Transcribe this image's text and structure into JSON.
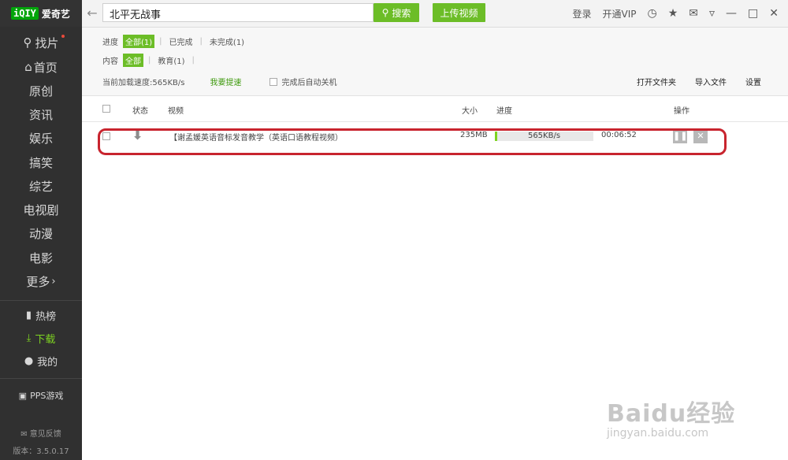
{
  "app": {
    "logo_mark": "iQIY",
    "logo_text": "爱奇艺"
  },
  "search": {
    "value": "北平无战事",
    "button": "搜索"
  },
  "upload_label": "上传视频",
  "top_right": {
    "login": "登录",
    "vip": "开通VIP"
  },
  "sidebar": {
    "find": "找片",
    "items": [
      "首页",
      "原创",
      "资讯",
      "娱乐",
      "搞笑",
      "综艺",
      "电视剧",
      "动漫",
      "电影",
      "更多"
    ],
    "more_arrow": "›",
    "hot": "热榜",
    "download": "下载",
    "mine": "我的",
    "games": "PPS游戏",
    "feedback": "意见反馈",
    "version": "版本：3.5.0.17"
  },
  "filters": {
    "progress_label": "进度",
    "progress_options": [
      "全部(1)",
      "已完成",
      "未完成(1)"
    ],
    "content_label": "内容",
    "content_options": [
      "全部",
      "教育(1)"
    ],
    "speed_text": "当前加载速度:565KB/s",
    "accelerate": "我要提速",
    "autoshutdown": "完成后自动关机",
    "actions": [
      "打开文件夹",
      "导入文件",
      "设置"
    ]
  },
  "table": {
    "headers": {
      "status": "状态",
      "video": "视频",
      "size": "大小",
      "progress": "进度",
      "ops": "操作"
    },
    "rows": [
      {
        "title": "【谢孟媛英语音标发音教学（英语口语教程视频）",
        "size": "235MB",
        "speed": "565KB/s",
        "progress": 0.02,
        "time": "00:06:52"
      }
    ]
  },
  "watermark": {
    "main": "Baidu经验",
    "url": "jingyan.baidu.com"
  },
  "colors": {
    "accent": "#6cbd27",
    "sidebar_bg": "#303030",
    "highlight": "#c8242e"
  }
}
